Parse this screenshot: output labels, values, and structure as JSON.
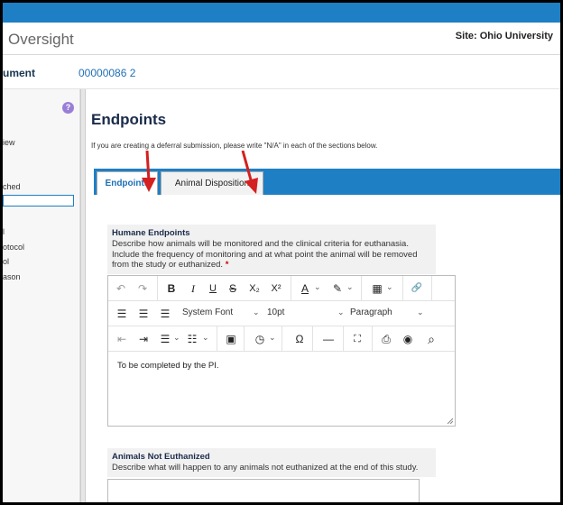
{
  "header": {
    "app_title": "Oversight",
    "site_label": "Site: Ohio University"
  },
  "subheader": {
    "doc_label": "ument",
    "doc_number": "00000086 2"
  },
  "sidebar": {
    "help_icon": "?",
    "items": [
      {
        "label": "iew"
      },
      {
        "label": "ched"
      },
      {
        "label": "l"
      },
      {
        "label": "otocol"
      },
      {
        "label": "ol"
      },
      {
        "label": "ason"
      }
    ]
  },
  "main": {
    "title": "Endpoints",
    "intro": "If you are creating a deferral submission, please write \"N/A\" in each of the sections below.",
    "tabs": [
      {
        "label": "Endpoints",
        "active": true
      },
      {
        "label": "Animal Disposition",
        "active": false
      }
    ],
    "annotation_color": "#d42020",
    "accent_color": "#1f7fc4"
  },
  "humane_endpoints": {
    "label": "Humane Endpoints",
    "description": "Describe how animals will be monitored and the clinical criteria for euthanasia. Include the frequency of monitoring and at what point the animal will be removed from the study or euthanized.",
    "required_marker": "*",
    "editor_text": "To be completed by the PI."
  },
  "toolbar": {
    "row1": [
      {
        "icon": "undo-icon",
        "glyph": "↶"
      },
      {
        "icon": "redo-icon",
        "glyph": "↷"
      },
      {
        "icon": "bold-icon",
        "glyph": "B"
      },
      {
        "icon": "italic-icon",
        "glyph": "I"
      },
      {
        "icon": "underline-icon",
        "glyph": "U"
      },
      {
        "icon": "strikethrough-icon",
        "glyph": "S"
      },
      {
        "icon": "subscript-icon",
        "glyph": "X₂"
      },
      {
        "icon": "superscript-icon",
        "glyph": "X²"
      },
      {
        "icon": "text-color-icon",
        "glyph": "A"
      },
      {
        "icon": "highlight-icon",
        "glyph": "✎"
      },
      {
        "icon": "table-icon",
        "glyph": "▦"
      },
      {
        "icon": "link-icon",
        "glyph": "🔗"
      }
    ],
    "font_family": "System Font",
    "font_size": "10pt",
    "block_format": "Paragraph",
    "row3": [
      {
        "icon": "outdent-icon",
        "glyph": "⇤"
      },
      {
        "icon": "indent-icon",
        "glyph": "⇥"
      },
      {
        "icon": "bullet-list-icon",
        "glyph": "☰"
      },
      {
        "icon": "numbered-list-icon",
        "glyph": "☷"
      },
      {
        "icon": "image-icon",
        "glyph": "▣"
      },
      {
        "icon": "clock-icon",
        "glyph": "◷"
      },
      {
        "icon": "special-char-icon",
        "glyph": "Ω"
      },
      {
        "icon": "horizontal-rule-icon",
        "glyph": "—"
      },
      {
        "icon": "fullscreen-icon",
        "glyph": "⛶"
      },
      {
        "icon": "print-icon",
        "glyph": "⎙"
      },
      {
        "icon": "preview-icon",
        "glyph": "◉"
      },
      {
        "icon": "search-icon",
        "glyph": "⌕"
      }
    ]
  },
  "animals_not_euthanized": {
    "label": "Animals Not Euthanized",
    "description": "Describe what will happen to any animals not euthanized at the end of this study."
  }
}
